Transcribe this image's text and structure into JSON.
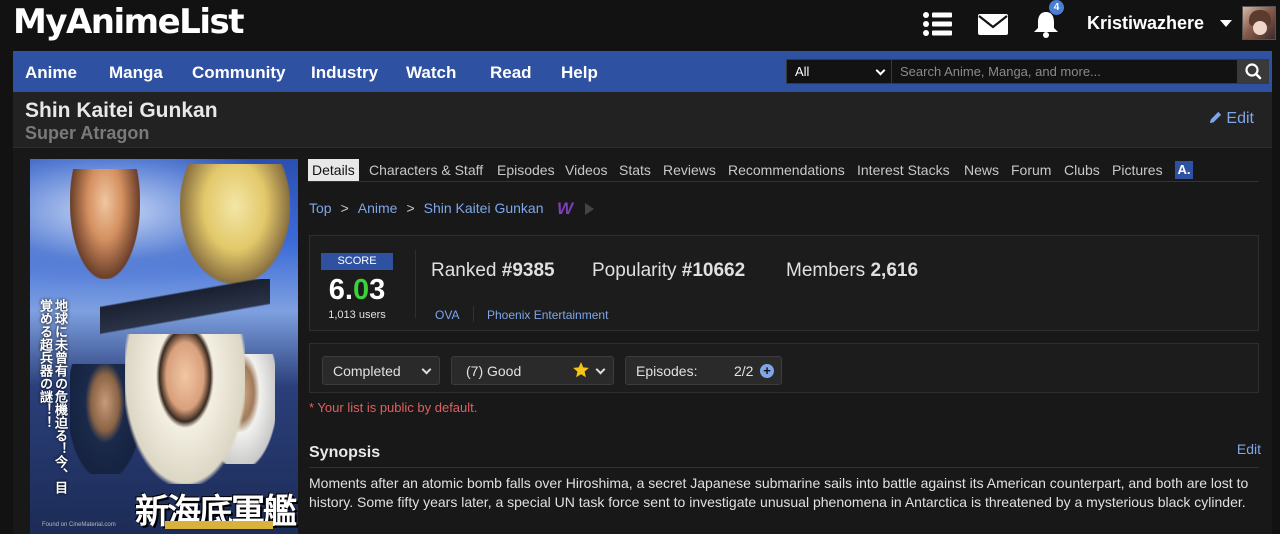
{
  "header": {
    "logo": "MyAnimeList",
    "notification_count": "4",
    "username": "Kristiwazhere",
    "icons": [
      "list-icon",
      "mail-icon",
      "bell-icon",
      "caret-down-icon"
    ]
  },
  "nav": {
    "items": [
      "Anime",
      "Manga",
      "Community",
      "Industry",
      "Watch",
      "Read",
      "Help"
    ],
    "search_scope": "All",
    "search_placeholder": "Search Anime, Manga, and more..."
  },
  "anime": {
    "title": "Shin Kaitei Gunkan",
    "english_title": "Super Atragon",
    "edit_label": "Edit",
    "poster_text": {
      "vertical": "地球に未曾有の危機迫る！今、目覚める超兵器の謎！！",
      "title": "新海底軍艦",
      "credit": "Found on CineMaterial.com"
    }
  },
  "tabs": [
    "Details",
    "Characters & Staff",
    "Episodes",
    "Videos",
    "Stats",
    "Reviews",
    "Recommendations",
    "Interest Stacks",
    "News",
    "Forum",
    "Clubs",
    "Pictures"
  ],
  "tab_extra_icon": "A.",
  "active_tab": "Details",
  "breadcrumb": [
    "Top",
    "Anime",
    "Shin Kaitei Gunkan"
  ],
  "breadcrumb_sep": ">",
  "stats": {
    "score_label": "SCORE",
    "score_int": "6.",
    "score_mid": "0",
    "score_end": "3",
    "score_users": "1,013 users",
    "ranked_label": "Ranked",
    "ranked_value": "#9385",
    "popularity_label": "Popularity",
    "popularity_value": "#10662",
    "members_label": "Members",
    "members_value": "2,616",
    "type": "OVA",
    "studio": "Phoenix Entertainment"
  },
  "status": {
    "list_status": "Completed",
    "rating": "(7) Good",
    "episodes_label": "Episodes:",
    "episodes_value": "2/2",
    "plus": "+"
  },
  "public_note": "* Your list is public by default.",
  "synopsis": {
    "heading": "Synopsis",
    "edit_label": "Edit",
    "text": "Moments after an atomic bomb falls over Hiroshima, a secret Japanese submarine sails into battle against its American counterpart, and both are lost to history. Some fifty years later, a special UN task force sent to investigate unusual phenomena in Antarctica is threatened by a mysterious black cylinder."
  },
  "colors": {
    "nav_blue": "#2e51a2",
    "link_blue": "#7ea6e8",
    "score_green": "#3cd13c",
    "note_red": "#e06060"
  }
}
